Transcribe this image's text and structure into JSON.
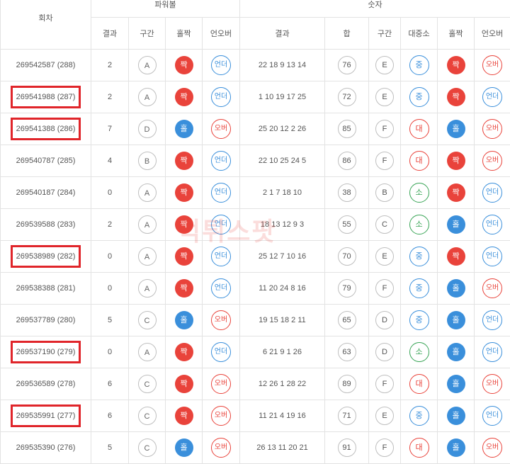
{
  "headers": {
    "round": "회차",
    "group1": "파워볼",
    "group2": "숫자",
    "pb_cols": [
      "결과",
      "구간",
      "홀짝",
      "언오버"
    ],
    "num_cols": [
      "결과",
      "합",
      "구간",
      "대중소",
      "홀짝",
      "언오버"
    ]
  },
  "watermark": "먹튀스팟",
  "rows": [
    {
      "round": "269542587 (288)",
      "marked": false,
      "pb_result": "2",
      "pb_zone": "A",
      "pb_oe": "짝",
      "pb_oe_type": "even",
      "pb_uo": "언더",
      "pb_uo_type": "under",
      "nums": "22 18 9 13 14",
      "sum": "76",
      "zone": "E",
      "size": "중",
      "size_type": "mid",
      "oe": "짝",
      "oe_type": "even",
      "uo": "오버",
      "uo_type": "over"
    },
    {
      "round": "269541988 (287)",
      "marked": true,
      "pb_result": "2",
      "pb_zone": "A",
      "pb_oe": "짝",
      "pb_oe_type": "even",
      "pb_uo": "언더",
      "pb_uo_type": "under",
      "nums": "1 10 19 17 25",
      "sum": "72",
      "zone": "E",
      "size": "중",
      "size_type": "mid",
      "oe": "짝",
      "oe_type": "even",
      "uo": "언더",
      "uo_type": "under"
    },
    {
      "round": "269541388 (286)",
      "marked": true,
      "pb_result": "7",
      "pb_zone": "D",
      "pb_oe": "홀",
      "pb_oe_type": "odd",
      "pb_uo": "오버",
      "pb_uo_type": "over",
      "nums": "25 20 12 2 26",
      "sum": "85",
      "zone": "F",
      "size": "대",
      "size_type": "large",
      "oe": "홀",
      "oe_type": "odd",
      "uo": "오버",
      "uo_type": "over"
    },
    {
      "round": "269540787 (285)",
      "marked": false,
      "pb_result": "4",
      "pb_zone": "B",
      "pb_oe": "짝",
      "pb_oe_type": "even",
      "pb_uo": "언더",
      "pb_uo_type": "under",
      "nums": "22 10 25 24 5",
      "sum": "86",
      "zone": "F",
      "size": "대",
      "size_type": "large",
      "oe": "짝",
      "oe_type": "even",
      "uo": "오버",
      "uo_type": "over"
    },
    {
      "round": "269540187 (284)",
      "marked": false,
      "pb_result": "0",
      "pb_zone": "A",
      "pb_oe": "짝",
      "pb_oe_type": "even",
      "pb_uo": "언더",
      "pb_uo_type": "under",
      "nums": "2 1 7 18 10",
      "sum": "38",
      "zone": "B",
      "size": "소",
      "size_type": "small",
      "oe": "짝",
      "oe_type": "even",
      "uo": "언더",
      "uo_type": "under"
    },
    {
      "round": "269539588 (283)",
      "marked": false,
      "pb_result": "2",
      "pb_zone": "A",
      "pb_oe": "짝",
      "pb_oe_type": "even",
      "pb_uo": "언더",
      "pb_uo_type": "under",
      "nums": "18 13 12 9 3",
      "sum": "55",
      "zone": "C",
      "size": "소",
      "size_type": "small",
      "oe": "홀",
      "oe_type": "odd",
      "uo": "언더",
      "uo_type": "under"
    },
    {
      "round": "269538989 (282)",
      "marked": true,
      "pb_result": "0",
      "pb_zone": "A",
      "pb_oe": "짝",
      "pb_oe_type": "even",
      "pb_uo": "언더",
      "pb_uo_type": "under",
      "nums": "25 12 7 10 16",
      "sum": "70",
      "zone": "E",
      "size": "중",
      "size_type": "mid",
      "oe": "짝",
      "oe_type": "even",
      "uo": "언더",
      "uo_type": "under"
    },
    {
      "round": "269538388 (281)",
      "marked": false,
      "pb_result": "0",
      "pb_zone": "A",
      "pb_oe": "짝",
      "pb_oe_type": "even",
      "pb_uo": "언더",
      "pb_uo_type": "under",
      "nums": "11 20 24 8 16",
      "sum": "79",
      "zone": "F",
      "size": "중",
      "size_type": "mid",
      "oe": "홀",
      "oe_type": "odd",
      "uo": "오버",
      "uo_type": "over"
    },
    {
      "round": "269537789 (280)",
      "marked": false,
      "pb_result": "5",
      "pb_zone": "C",
      "pb_oe": "홀",
      "pb_oe_type": "odd",
      "pb_uo": "오버",
      "pb_uo_type": "over",
      "nums": "19 15 18 2 11",
      "sum": "65",
      "zone": "D",
      "size": "중",
      "size_type": "mid",
      "oe": "홀",
      "oe_type": "odd",
      "uo": "언더",
      "uo_type": "under"
    },
    {
      "round": "269537190 (279)",
      "marked": true,
      "pb_result": "0",
      "pb_zone": "A",
      "pb_oe": "짝",
      "pb_oe_type": "even",
      "pb_uo": "언더",
      "pb_uo_type": "under",
      "nums": "6 21 9 1 26",
      "sum": "63",
      "zone": "D",
      "size": "소",
      "size_type": "small",
      "oe": "홀",
      "oe_type": "odd",
      "uo": "언더",
      "uo_type": "under"
    },
    {
      "round": "269536589 (278)",
      "marked": false,
      "pb_result": "6",
      "pb_zone": "C",
      "pb_oe": "짝",
      "pb_oe_type": "even",
      "pb_uo": "오버",
      "pb_uo_type": "over",
      "nums": "12 26 1 28 22",
      "sum": "89",
      "zone": "F",
      "size": "대",
      "size_type": "large",
      "oe": "홀",
      "oe_type": "odd",
      "uo": "오버",
      "uo_type": "over"
    },
    {
      "round": "269535991 (277)",
      "marked": true,
      "pb_result": "6",
      "pb_zone": "C",
      "pb_oe": "짝",
      "pb_oe_type": "even",
      "pb_uo": "오버",
      "pb_uo_type": "over",
      "nums": "11 21 4 19 16",
      "sum": "71",
      "zone": "E",
      "size": "중",
      "size_type": "mid",
      "oe": "홀",
      "oe_type": "odd",
      "uo": "언더",
      "uo_type": "under"
    },
    {
      "round": "269535390 (276)",
      "marked": false,
      "pb_result": "5",
      "pb_zone": "C",
      "pb_oe": "홀",
      "pb_oe_type": "odd",
      "pb_uo": "오버",
      "pb_uo_type": "over",
      "nums": "26 13 11 20 21",
      "sum": "91",
      "zone": "F",
      "size": "대",
      "size_type": "large",
      "oe": "홀",
      "oe_type": "odd",
      "uo": "오버",
      "uo_type": "over"
    }
  ]
}
